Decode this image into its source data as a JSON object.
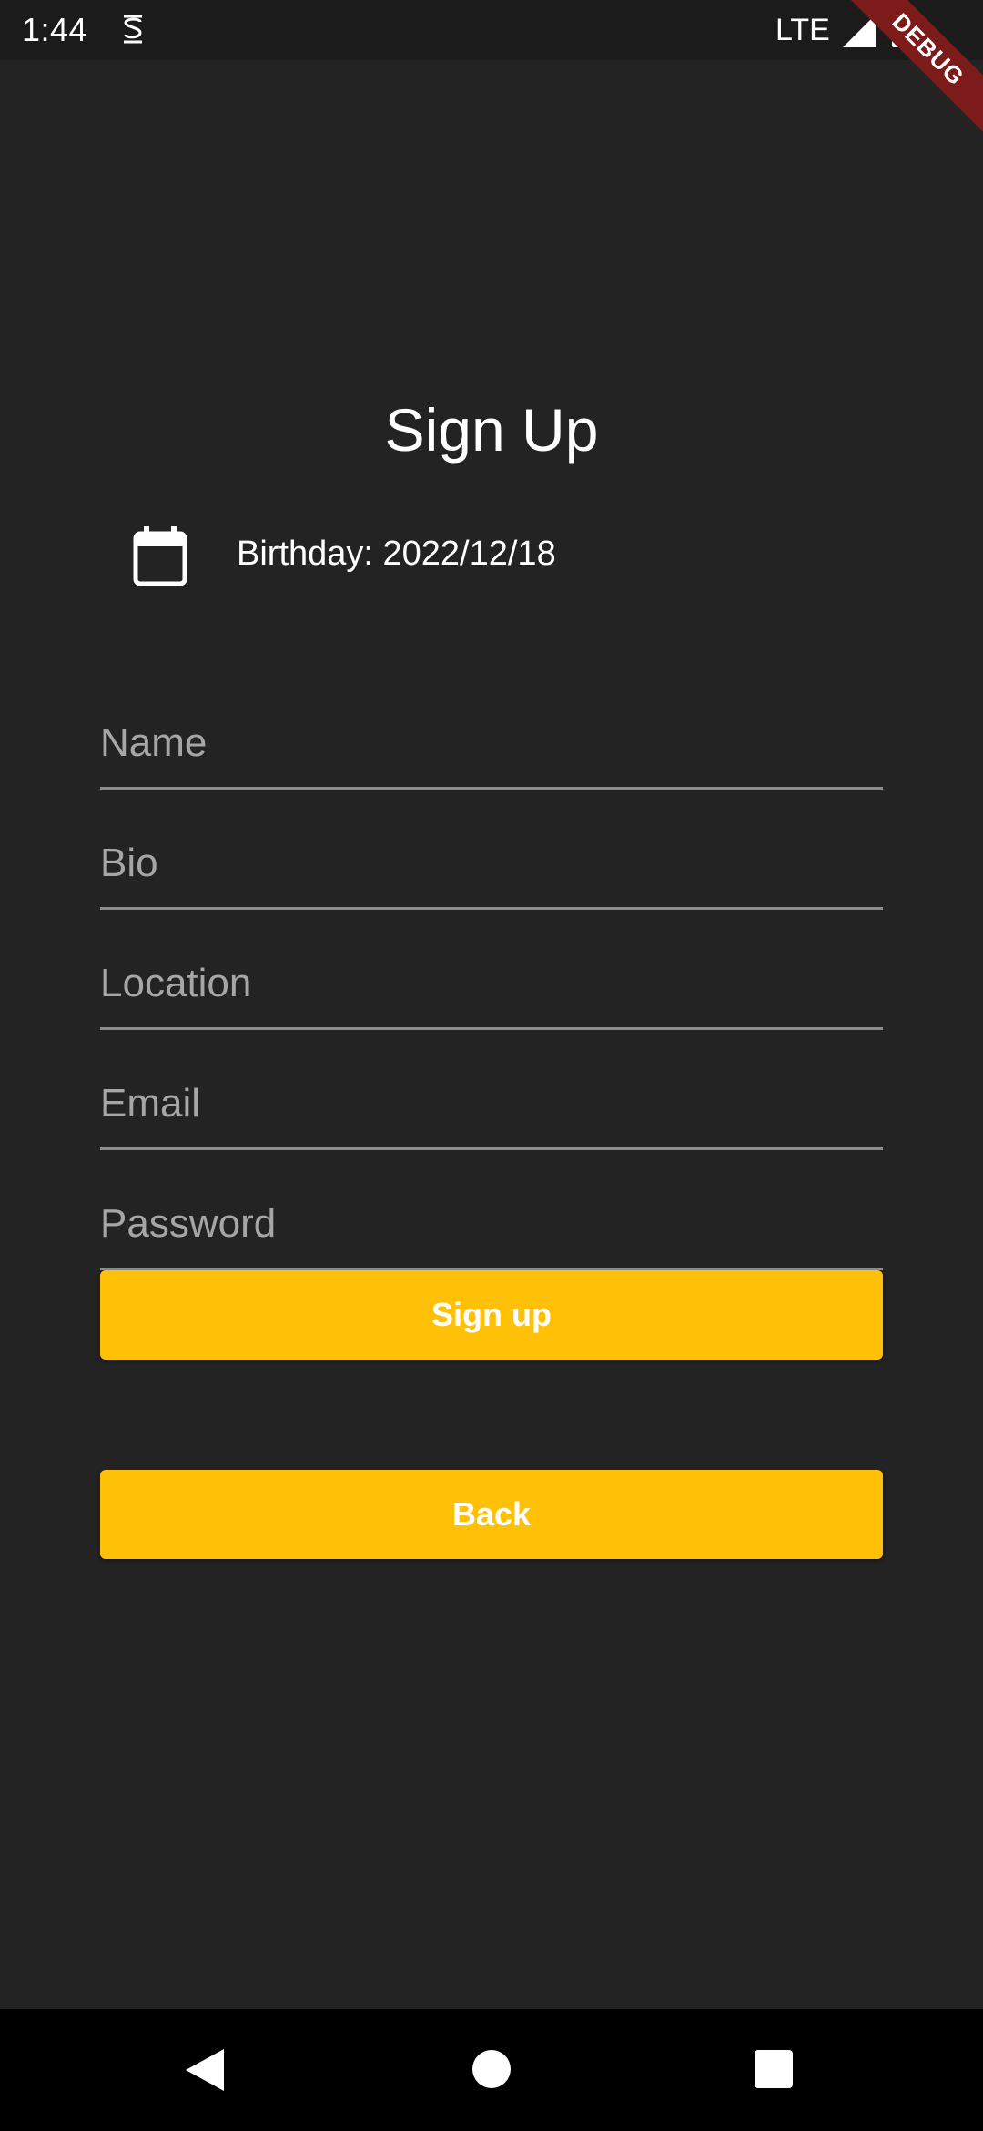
{
  "status_bar": {
    "time": "1:44",
    "network": "LTE",
    "icons": [
      "app-notification-icon",
      "signal-icon",
      "battery-icon"
    ]
  },
  "debug_banner": {
    "label": "DEBUG",
    "color": "#7d1a1a"
  },
  "screen": {
    "title": "Sign Up",
    "birthday": {
      "icon": "calendar-icon",
      "label": "Birthday: 2022/12/18"
    },
    "fields": [
      {
        "placeholder": "Name",
        "value": ""
      },
      {
        "placeholder": "Bio",
        "value": ""
      },
      {
        "placeholder": "Location",
        "value": ""
      },
      {
        "placeholder": "Email",
        "value": ""
      },
      {
        "placeholder": "Password",
        "value": ""
      }
    ],
    "signup_button_label": "Sign up",
    "back_button_label": "Back"
  },
  "nav_bar": {
    "icons": [
      "back-triangle-icon",
      "home-circle-icon",
      "recents-square-icon"
    ]
  },
  "colors": {
    "background": "#232323",
    "status_bar": "#1b1b1b",
    "accent": "#ffc107",
    "underline": "#8c8c8c",
    "placeholder": "#a6a6a6",
    "text": "#ffffff"
  }
}
